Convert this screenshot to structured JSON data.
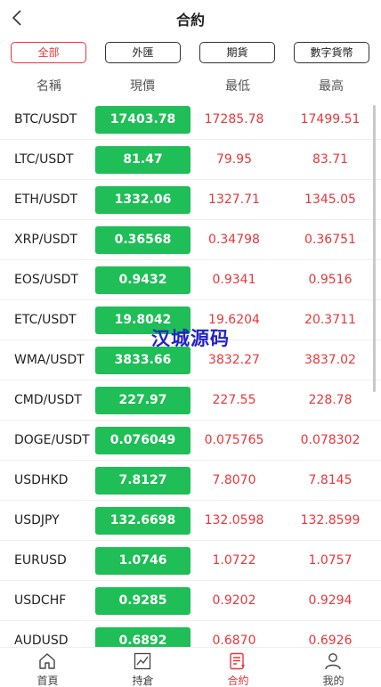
{
  "header": {
    "title": "合約"
  },
  "filters": [
    {
      "label": "全部",
      "active": true
    },
    {
      "label": "外匯",
      "active": false
    },
    {
      "label": "期貨",
      "active": false
    },
    {
      "label": "數字貨幣",
      "active": false
    }
  ],
  "columns": {
    "name": "名稱",
    "price": "現價",
    "low": "最低",
    "high": "最高"
  },
  "rows": [
    {
      "name": "BTC/USDT",
      "price": "17403.78",
      "low": "17285.78",
      "high": "17499.51"
    },
    {
      "name": "LTC/USDT",
      "price": "81.47",
      "low": "79.95",
      "high": "83.71"
    },
    {
      "name": "ETH/USDT",
      "price": "1332.06",
      "low": "1327.71",
      "high": "1345.05"
    },
    {
      "name": "XRP/USDT",
      "price": "0.36568",
      "low": "0.34798",
      "high": "0.36751"
    },
    {
      "name": "EOS/USDT",
      "price": "0.9432",
      "low": "0.9341",
      "high": "0.9516"
    },
    {
      "name": "ETC/USDT",
      "price": "19.8042",
      "low": "19.6204",
      "high": "20.3711"
    },
    {
      "name": "WMA/USDT",
      "price": "3833.66",
      "low": "3832.27",
      "high": "3837.02"
    },
    {
      "name": "CMD/USDT",
      "price": "227.97",
      "low": "227.55",
      "high": "228.78"
    },
    {
      "name": "DOGE/USDT",
      "price": "0.076049",
      "low": "0.075765",
      "high": "0.078302"
    },
    {
      "name": "USDHKD",
      "price": "7.8127",
      "low": "7.8070",
      "high": "7.8145"
    },
    {
      "name": "USDJPY",
      "price": "132.6698",
      "low": "132.0598",
      "high": "132.8599"
    },
    {
      "name": "EURUSD",
      "price": "1.0746",
      "low": "1.0722",
      "high": "1.0757"
    },
    {
      "name": "USDCHF",
      "price": "0.9285",
      "low": "0.9202",
      "high": "0.9294"
    },
    {
      "name": "AUDUSD",
      "price": "0.6892",
      "low": "0.6870",
      "high": "0.6926"
    }
  ],
  "watermark": "汉城源码",
  "tabbar": [
    {
      "label": "首頁",
      "icon": "home-icon",
      "active": false
    },
    {
      "label": "持倉",
      "icon": "chart-icon",
      "active": false
    },
    {
      "label": "合約",
      "icon": "contract-icon",
      "active": true
    },
    {
      "label": "我的",
      "icon": "user-icon",
      "active": false
    }
  ],
  "colors": {
    "accent": "#e8363b",
    "price_bg": "#1fbe57",
    "watermark": "#2222c8"
  }
}
